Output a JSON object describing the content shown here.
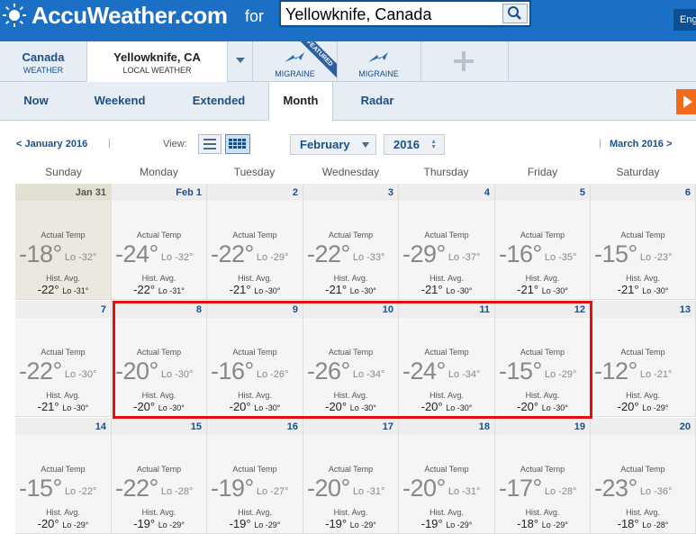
{
  "header": {
    "logo_text": "AccuWeather.com",
    "for_label": "for",
    "search_value": "Yellowknife, Canada",
    "lang_label": "Eng"
  },
  "locations": {
    "country_name": "Canada",
    "country_sub": "WEATHER",
    "city_name": "Yellowknife, CA",
    "city_sub": "LOCAL WEATHER",
    "featured_badge": "FEATURED",
    "tab1_label": "MIGRAINE",
    "tab2_label": "MIGRAINE"
  },
  "nav": {
    "tabs": [
      "Now",
      "Weekend",
      "Extended",
      "Month",
      "Radar"
    ],
    "active": "Month"
  },
  "month_controls": {
    "prev": "< January 2016",
    "view_label": "View:",
    "month_select": "February",
    "year_select": "2016",
    "next": "March 2016 >"
  },
  "calendar": {
    "weekdays": [
      "Sunday",
      "Monday",
      "Tuesday",
      "Wednesday",
      "Thursday",
      "Friday",
      "Saturday"
    ],
    "actual_label": "Actual Temp",
    "hist_label": "Hist. Avg.",
    "weeks": [
      [
        {
          "date": "Jan 31",
          "hi": "-18°",
          "lo": "Lo -32°",
          "hist_hi": "-22°",
          "hist_lo": "Lo -31°",
          "other_month": true
        },
        {
          "date": "Feb 1",
          "hi": "-24°",
          "lo": "Lo -32°",
          "hist_hi": "-22°",
          "hist_lo": "Lo -31°"
        },
        {
          "date": "2",
          "hi": "-22°",
          "lo": "Lo -29°",
          "hist_hi": "-21°",
          "hist_lo": "Lo -30°"
        },
        {
          "date": "3",
          "hi": "-22°",
          "lo": "Lo -33°",
          "hist_hi": "-21°",
          "hist_lo": "Lo -30°"
        },
        {
          "date": "4",
          "hi": "-29°",
          "lo": "Lo -37°",
          "hist_hi": "-21°",
          "hist_lo": "Lo -30°"
        },
        {
          "date": "5",
          "hi": "-16°",
          "lo": "Lo -35°",
          "hist_hi": "-21°",
          "hist_lo": "Lo -30°"
        },
        {
          "date": "6",
          "hi": "-15°",
          "lo": "Lo -23°",
          "hist_hi": "-21°",
          "hist_lo": "Lo -30°"
        }
      ],
      [
        {
          "date": "7",
          "hi": "-22°",
          "lo": "Lo -30°",
          "hist_hi": "-21°",
          "hist_lo": "Lo -30°"
        },
        {
          "date": "8",
          "hi": "-20°",
          "lo": "Lo -30°",
          "hist_hi": "-20°",
          "hist_lo": "Lo -30°"
        },
        {
          "date": "9",
          "hi": "-16°",
          "lo": "Lo -26°",
          "hist_hi": "-20°",
          "hist_lo": "Lo -30°"
        },
        {
          "date": "10",
          "hi": "-26°",
          "lo": "Lo -34°",
          "hist_hi": "-20°",
          "hist_lo": "Lo -30°"
        },
        {
          "date": "11",
          "hi": "-24°",
          "lo": "Lo -34°",
          "hist_hi": "-20°",
          "hist_lo": "Lo -30°"
        },
        {
          "date": "12",
          "hi": "-15°",
          "lo": "Lo -29°",
          "hist_hi": "-20°",
          "hist_lo": "Lo -30°"
        },
        {
          "date": "13",
          "hi": "-12°",
          "lo": "Lo -21°",
          "hist_hi": "-20°",
          "hist_lo": "Lo -29°"
        }
      ],
      [
        {
          "date": "14",
          "hi": "-15°",
          "lo": "Lo -22°",
          "hist_hi": "-20°",
          "hist_lo": "Lo -29°"
        },
        {
          "date": "15",
          "hi": "-22°",
          "lo": "Lo -28°",
          "hist_hi": "-19°",
          "hist_lo": "Lo -29°"
        },
        {
          "date": "16",
          "hi": "-19°",
          "lo": "Lo -27°",
          "hist_hi": "-19°",
          "hist_lo": "Lo -29°"
        },
        {
          "date": "17",
          "hi": "-20°",
          "lo": "Lo -31°",
          "hist_hi": "-19°",
          "hist_lo": "Lo -29°"
        },
        {
          "date": "18",
          "hi": "-20°",
          "lo": "Lo -31°",
          "hist_hi": "-19°",
          "hist_lo": "Lo -29°"
        },
        {
          "date": "19",
          "hi": "-17°",
          "lo": "Lo -28°",
          "hist_hi": "-18°",
          "hist_lo": "Lo -29°"
        },
        {
          "date": "20",
          "hi": "-23°",
          "lo": "Lo -36°",
          "hist_hi": "-18°",
          "hist_lo": "Lo -28°"
        }
      ]
    ]
  },
  "colors": {
    "brand_blue": "#1b6fc4",
    "link_blue": "#1b4f88",
    "highlight_red": "#e01010",
    "video_orange": "#f26a1b"
  }
}
